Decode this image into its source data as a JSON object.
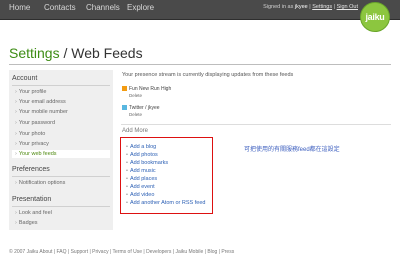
{
  "nav": {
    "home": "Home",
    "contacts": "Contacts",
    "channels": "Channels",
    "explore": "Explore"
  },
  "signin": {
    "prefix": "Signed in as",
    "user": "jkyee",
    "settings": "Settings",
    "signout": "Sign Out"
  },
  "logo": {
    "text": "jaiku",
    "color": "#8cc63f"
  },
  "page": {
    "title_green": "Settings",
    "title_rest": " / Web Feeds"
  },
  "sidebar": {
    "account_heading": "Account",
    "account_items": [
      "Your profile",
      "Your email address",
      "Your mobile number",
      "Your password",
      "Your photo",
      "Your privacy",
      "Your web feeds"
    ],
    "prefs_heading": "Preferences",
    "prefs_items": [
      "Notification options"
    ],
    "pres_heading": "Presentation",
    "pres_items": [
      "Look and feel",
      "Badges"
    ]
  },
  "main": {
    "intro": "Your presence stream is currently displaying updates from these feeds",
    "feeds": [
      {
        "name": "Fun New Run High",
        "action": "Delete"
      },
      {
        "name": "Twitter / jkyee",
        "action": "Delete"
      }
    ],
    "add_more": "Add More",
    "add_items": [
      "Add a blog",
      "Add photos",
      "Add bookmarks",
      "Add music",
      "Add places",
      "Add event",
      "Add video",
      "Add another Atom or RSS feed"
    ],
    "annotation": "可把使用的有關服務feed都在這設定"
  },
  "footer": "© 2007 Jaiku About | FAQ | Support | Privacy | Terms of Use | Developers | Jaiku Mobile | Blog | Press",
  "colors": {
    "accent": "#3d8c14",
    "link": "#2b5fb4",
    "highlight_box": "#d11111"
  }
}
